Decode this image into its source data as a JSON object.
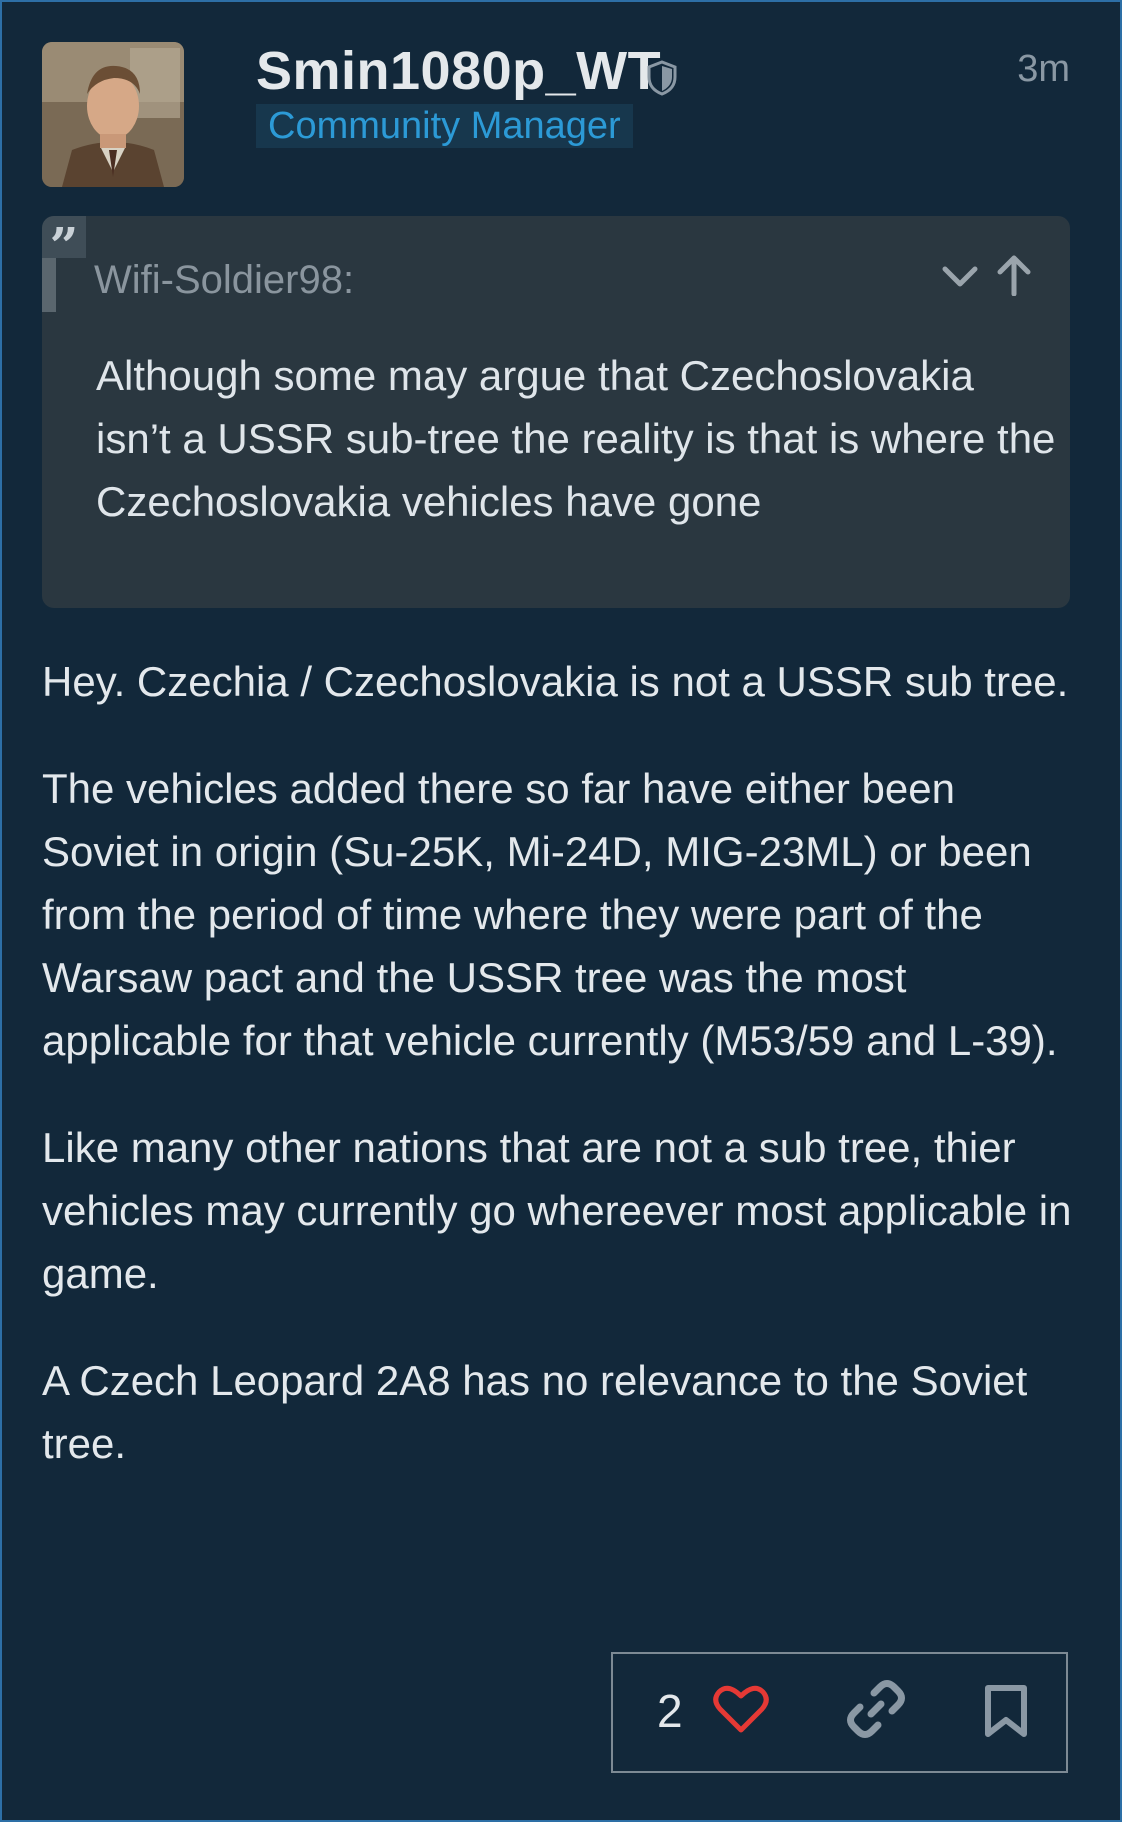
{
  "post": {
    "author": {
      "username": "Smin1080p_WT",
      "flair": "Community Manager",
      "avatar_icon": "avatar-portrait",
      "moderator_icon": "shield-icon"
    },
    "timestamp": "3m",
    "quote": {
      "icon": "quote-icon",
      "author": "Wifi-Soldier98:",
      "text": "Although some may argue that Czechoslovakia isn’t a USSR sub-tree the reality is that is where the Czechoslovakia vehicles have gone",
      "controls": [
        "chevron-down-icon",
        "arrow-up-icon"
      ]
    },
    "body": {
      "paragraphs": [
        "Hey. Czechia / Czechoslovakia is not a USSR sub tree.",
        "The vehicles added there so far have either been Soviet in origin (Su-25K, Mi-24D, MIG-23ML) or been from the period of time where they were part of the Warsaw pact and the USSR tree was the most applicable for that vehicle currently (M53/59 and L-39).",
        "Like many other nations that are not a sub tree, thier vehicles may currently go whereever most applicable in game.",
        "A Czech Leopard 2A8 has no relevance to the Soviet tree."
      ]
    },
    "actions": {
      "like_count": "2",
      "icons": [
        "heart-icon",
        "link-icon",
        "bookmark-icon"
      ]
    }
  },
  "colors": {
    "background": "#12283a",
    "frame_border": "#2d6fa6",
    "flair_text": "#2c9ad6",
    "like_heart": "#e53935",
    "quote_background": "#2a3740"
  }
}
